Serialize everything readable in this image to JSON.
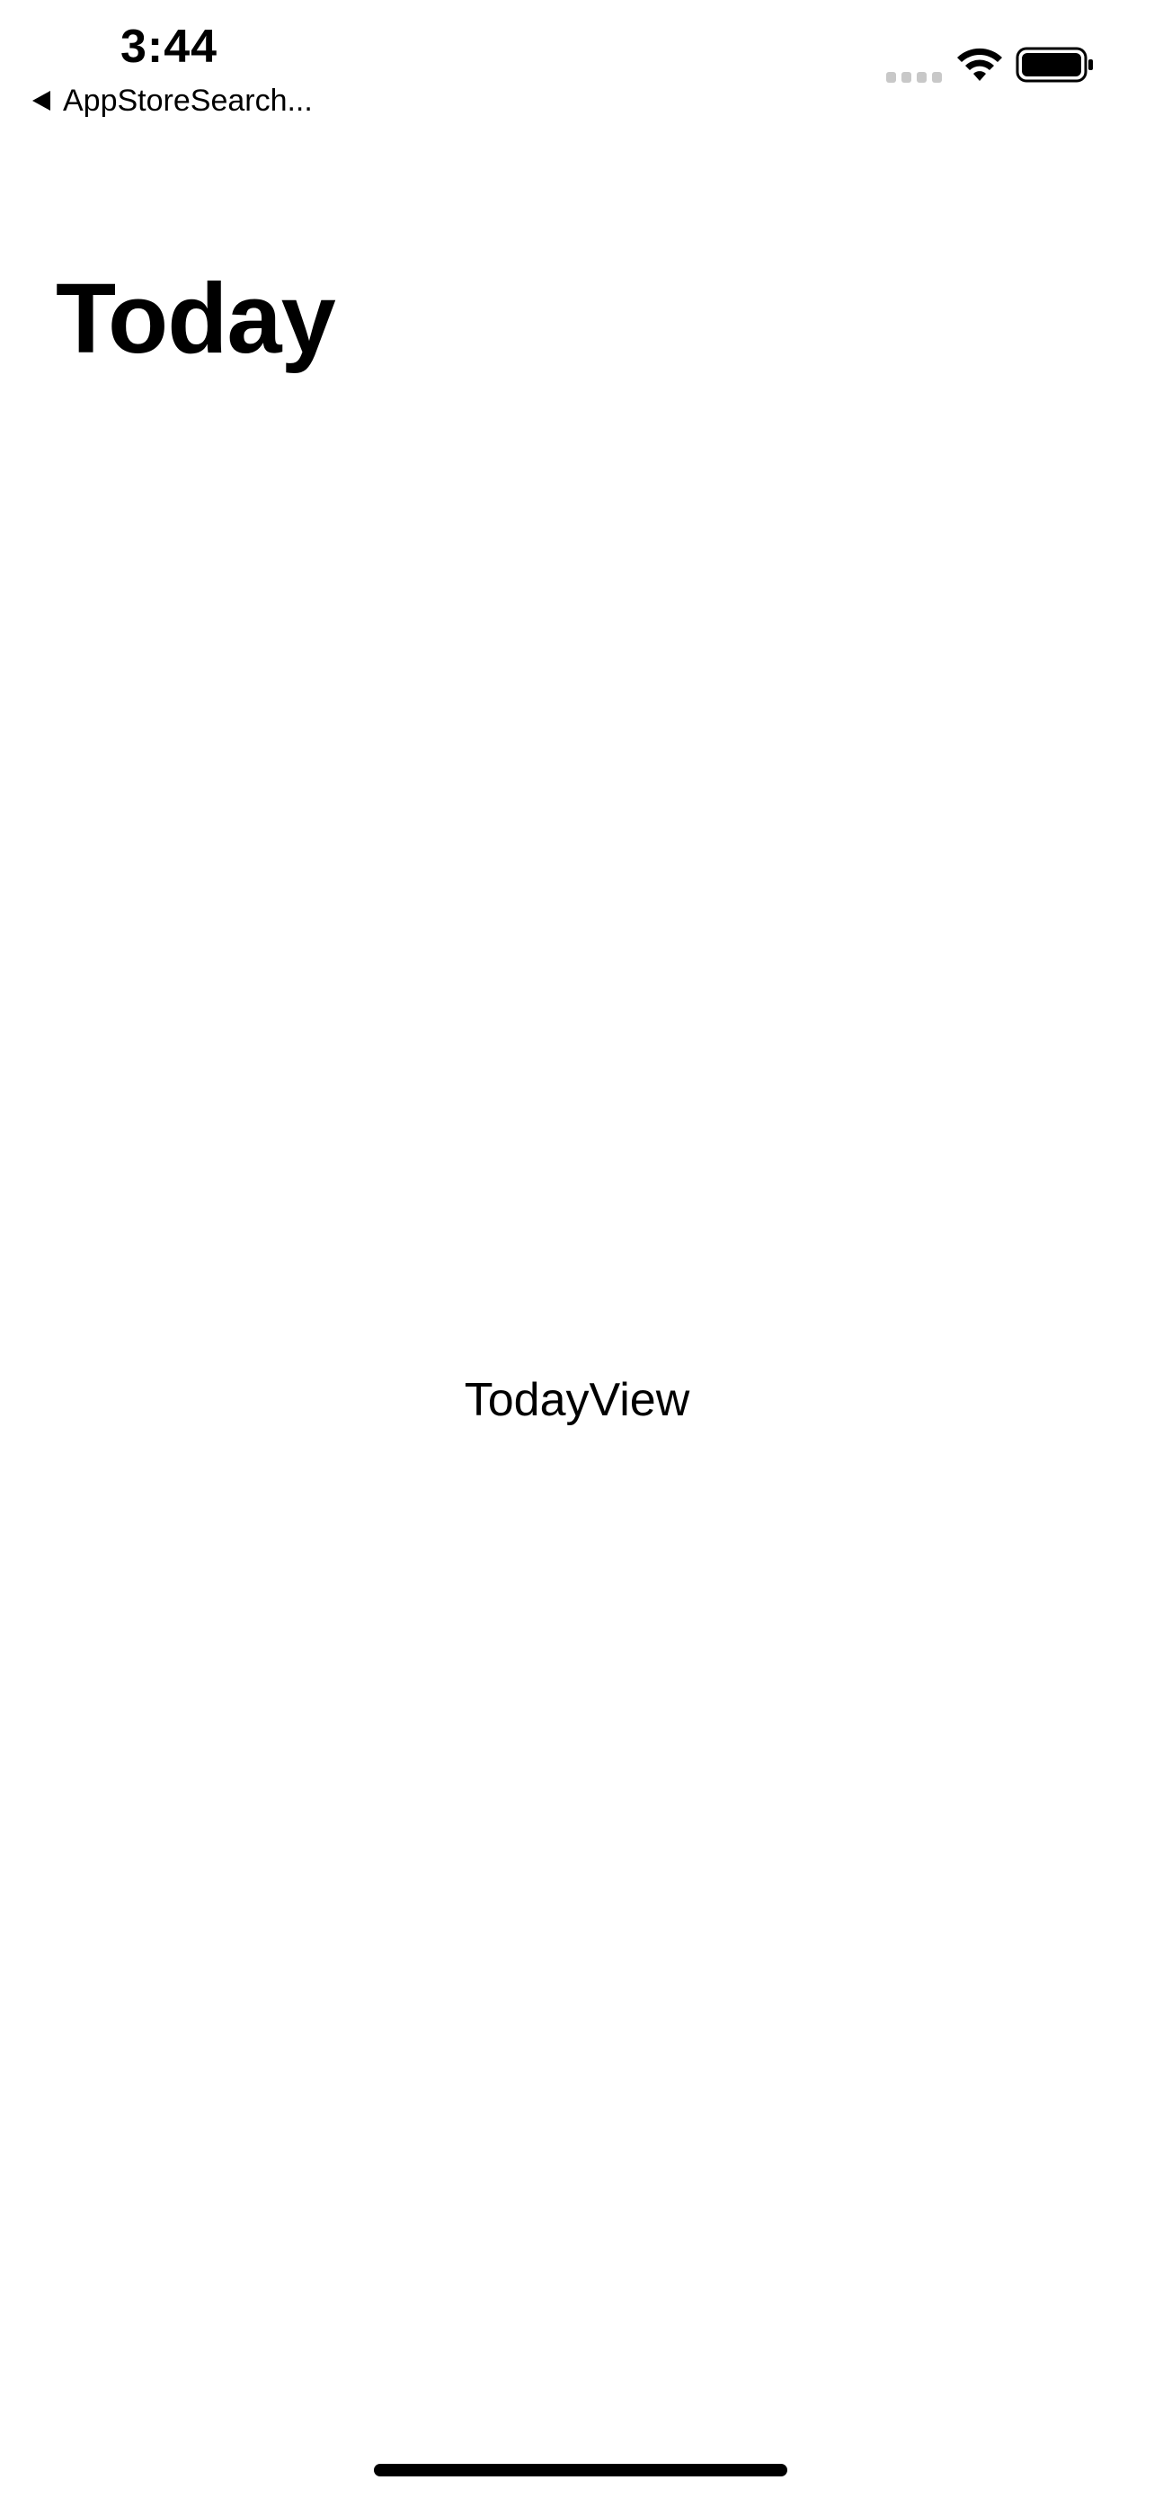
{
  "status_bar": {
    "time": "3:44",
    "back_label": "AppStoreSearch..."
  },
  "navigation": {
    "title": "Today"
  },
  "content": {
    "label": "TodayView"
  },
  "icons": {
    "signal": "cellular-signal-icon",
    "wifi": "wifi-icon",
    "battery": "battery-icon",
    "back": "back-chevron-icon"
  },
  "colors": {
    "text": "#000000",
    "background": "#ffffff",
    "signal_inactive": "#c8c8c8"
  }
}
